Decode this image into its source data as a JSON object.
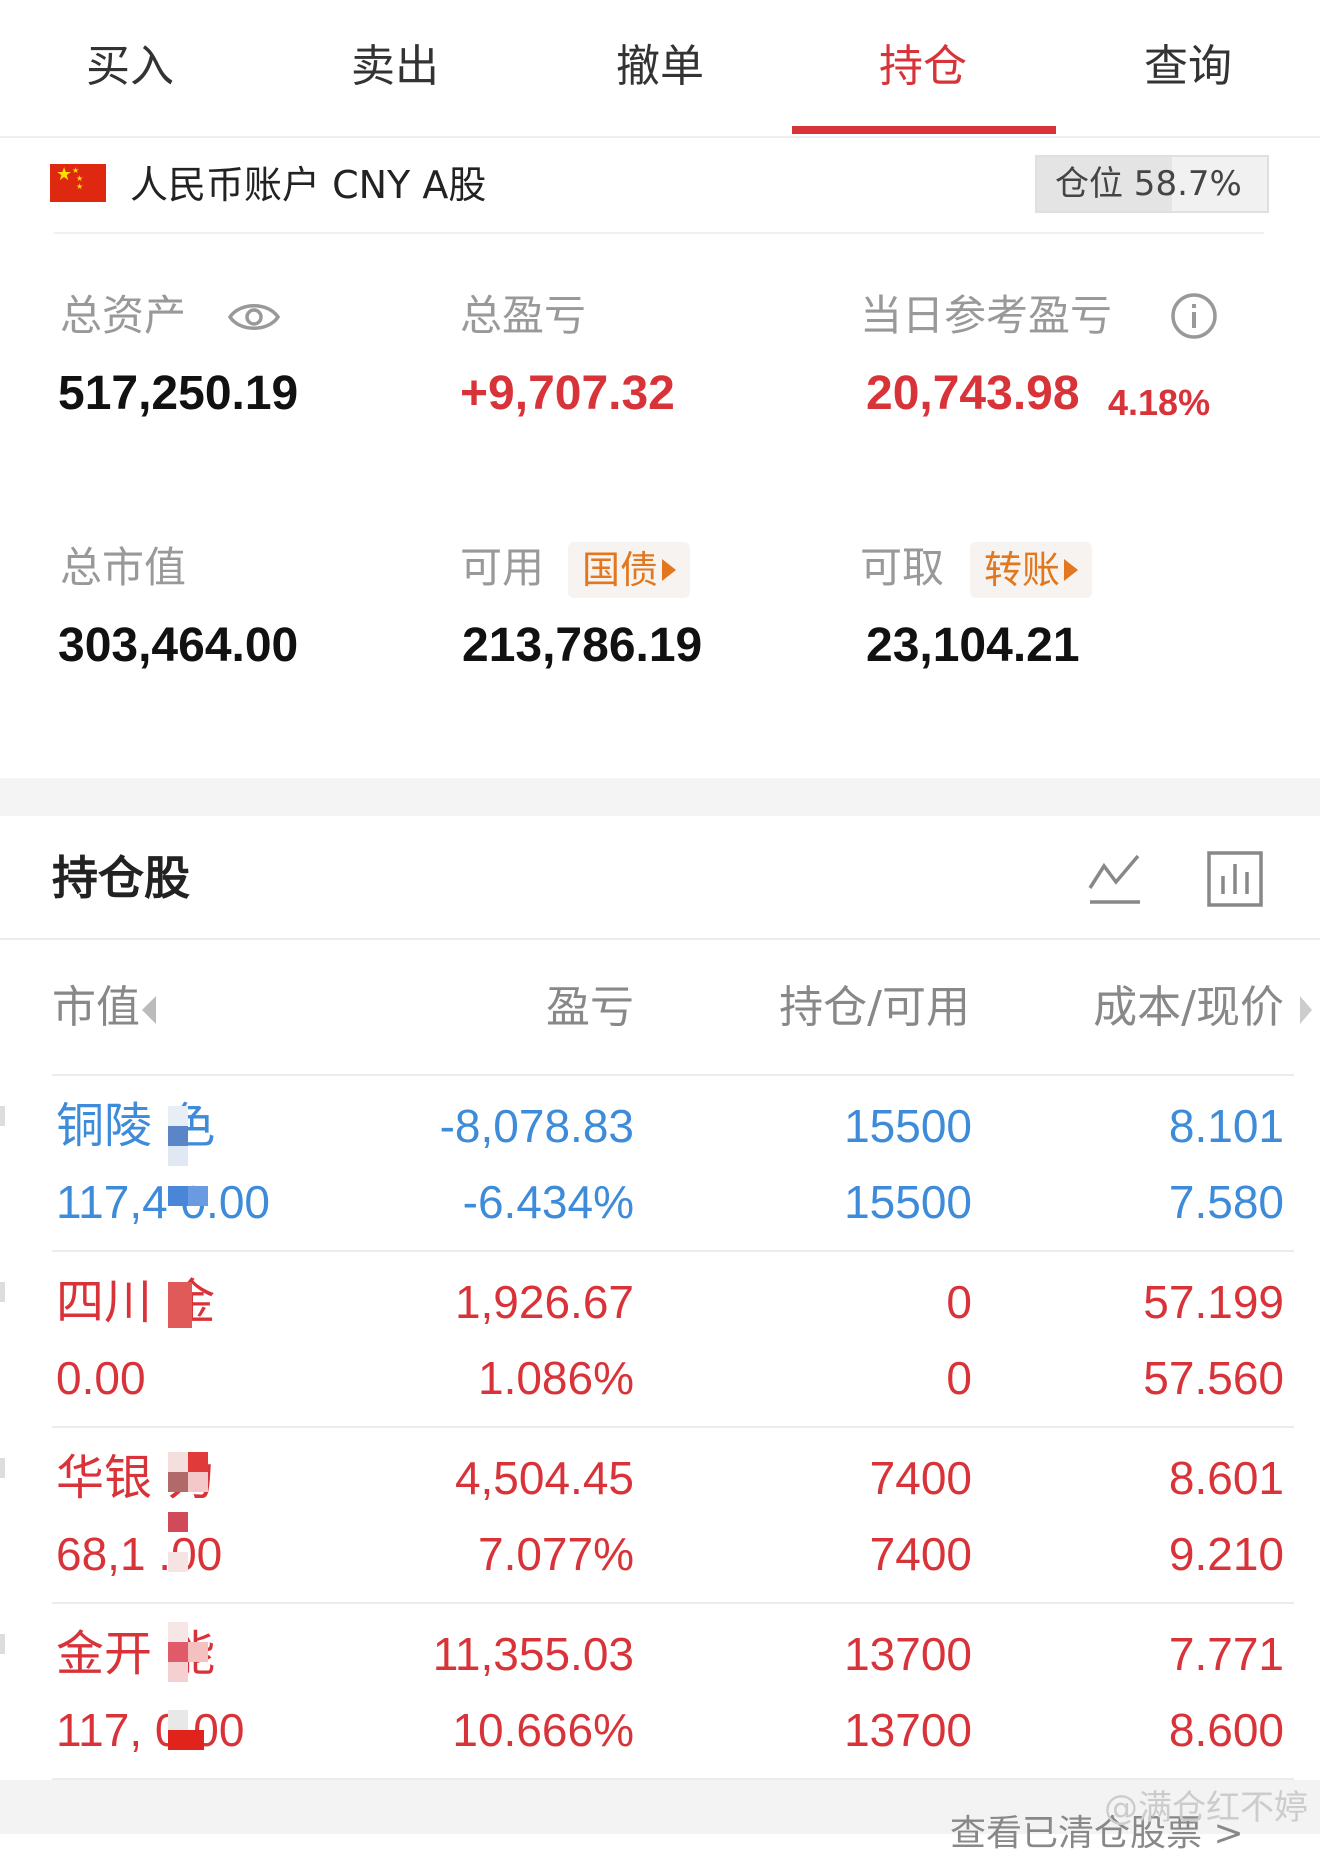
{
  "tabs": [
    {
      "label": "买入"
    },
    {
      "label": "卖出"
    },
    {
      "label": "撤单"
    },
    {
      "label": "持仓",
      "active": true
    },
    {
      "label": "查询"
    }
  ],
  "account": {
    "label": "人民币账户 CNY A股",
    "position_label": "仓位 58.7%",
    "position_ratio": 0.587
  },
  "summary": {
    "total_assets_label": "总资产",
    "total_assets": "517,250.19",
    "total_pl_label": "总盈亏",
    "total_pl": "+9,707.32",
    "daily_pl_label": "当日参考盈亏",
    "daily_pl": "20,743.98",
    "daily_pl_pct": "4.18%",
    "market_value_label": "总市值",
    "market_value": "303,464.00",
    "available_label": "可用",
    "available_tag": "国债",
    "available": "213,786.19",
    "withdrawable_label": "可取",
    "withdrawable_tag": "转账",
    "withdrawable": "23,104.21"
  },
  "holdings": {
    "title": "持仓股",
    "columns": {
      "market_value": "市值",
      "profit_loss": "盈亏",
      "position_available": "持仓/可用",
      "cost_price": "成本/现价"
    },
    "rows": [
      {
        "name": "铜陵 色",
        "market_value": "117,4 0.00",
        "pl": "-8,078.83",
        "pl_pct": "-6.434%",
        "position": "15500",
        "available": "15500",
        "cost": "8.101",
        "price": "7.580",
        "color": "blue"
      },
      {
        "name": "四川 金",
        "market_value": "0.00",
        "pl": "1,926.67",
        "pl_pct": "1.086%",
        "position": "0",
        "available": "0",
        "cost": "57.199",
        "price": "57.560",
        "color": "red"
      },
      {
        "name": "华银 力",
        "market_value": "68,1 .00",
        "pl": "4,504.45",
        "pl_pct": "7.077%",
        "position": "7400",
        "available": "7400",
        "cost": "8.601",
        "price": "9.210",
        "color": "red"
      },
      {
        "name": "金开 能",
        "market_value": "117, 0.00",
        "pl": "11,355.03",
        "pl_pct": "10.666%",
        "position": "13700",
        "available": "13700",
        "cost": "7.771",
        "price": "8.600",
        "color": "red"
      }
    ]
  },
  "footer": {
    "watermark": "@满仓红不婷",
    "more_text": "查看已清仓股票 >"
  },
  "colors": {
    "accent": "#d9333a",
    "down": "#3d8bd9",
    "tag": "#e2771f"
  },
  "icons": [
    "eye-icon",
    "info-icon",
    "trend-chart-icon",
    "bar-chart-icon",
    "china-flag-icon"
  ]
}
